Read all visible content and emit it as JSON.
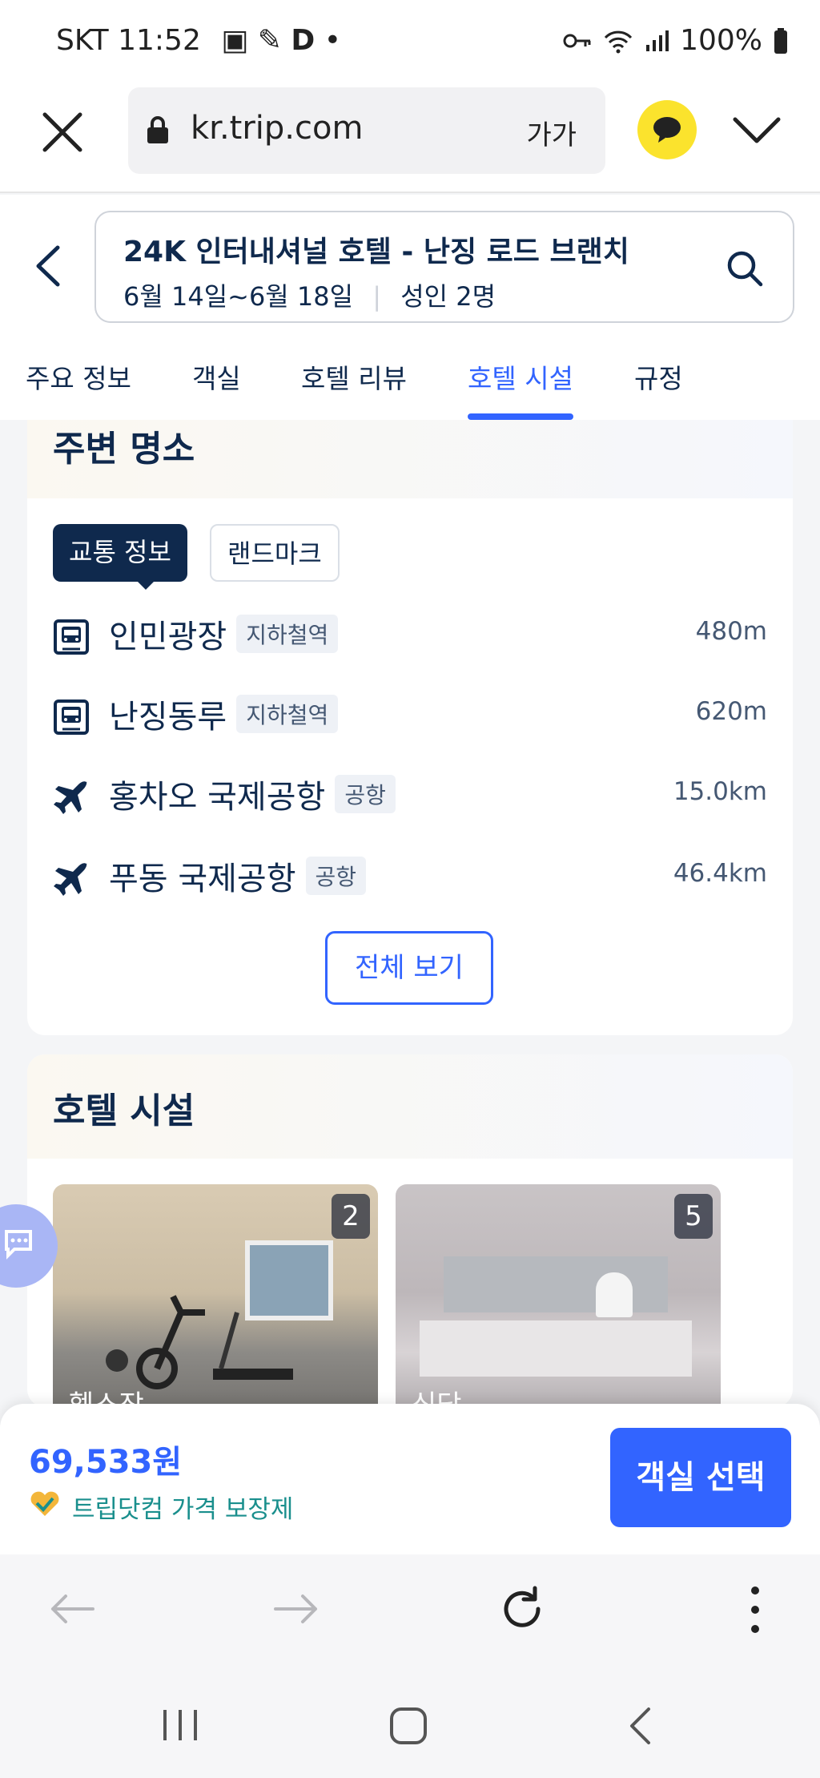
{
  "status_bar": {
    "carrier_time": "SKT 11:52",
    "battery": "100%"
  },
  "browser": {
    "url": "kr.trip.com",
    "text_size": "가가"
  },
  "search": {
    "hotel_name": "24K 인터내셔널 호텔 - 난징 로드 브랜치",
    "dates": "6월 14일~6월 18일",
    "guests": "성인 2명"
  },
  "tabs": [
    "주요 정보",
    "객실",
    "호텔 리뷰",
    "호텔 시설",
    "규정"
  ],
  "nearby": {
    "title": "주변 명소",
    "chips": [
      "교통 정보",
      "랜드마크"
    ],
    "items": [
      {
        "icon": "subway-icon",
        "name": "인민광장",
        "type": "지하철역",
        "distance": "480m"
      },
      {
        "icon": "subway-icon",
        "name": "난징동루",
        "type": "지하철역",
        "distance": "620m"
      },
      {
        "icon": "airplane-icon",
        "name": "홍차오 국제공항",
        "type": "공항",
        "distance": "15.0km"
      },
      {
        "icon": "airplane-icon",
        "name": "푸동 국제공항",
        "type": "공항",
        "distance": "46.4km"
      }
    ],
    "view_all": "전체 보기"
  },
  "facilities": {
    "title": "호텔 시설",
    "photos": [
      {
        "label": "헬스장",
        "count": "2"
      },
      {
        "label": "식당",
        "count": "5"
      }
    ]
  },
  "booking": {
    "price": "69,533원",
    "guarantee": "트립닷컴 가격 보장제",
    "select_button": "객실 선택"
  },
  "colors": {
    "accent": "#3264ff",
    "navy": "#0f294d",
    "teal": "#1a8f8d",
    "kakao": "#fbe32d"
  }
}
